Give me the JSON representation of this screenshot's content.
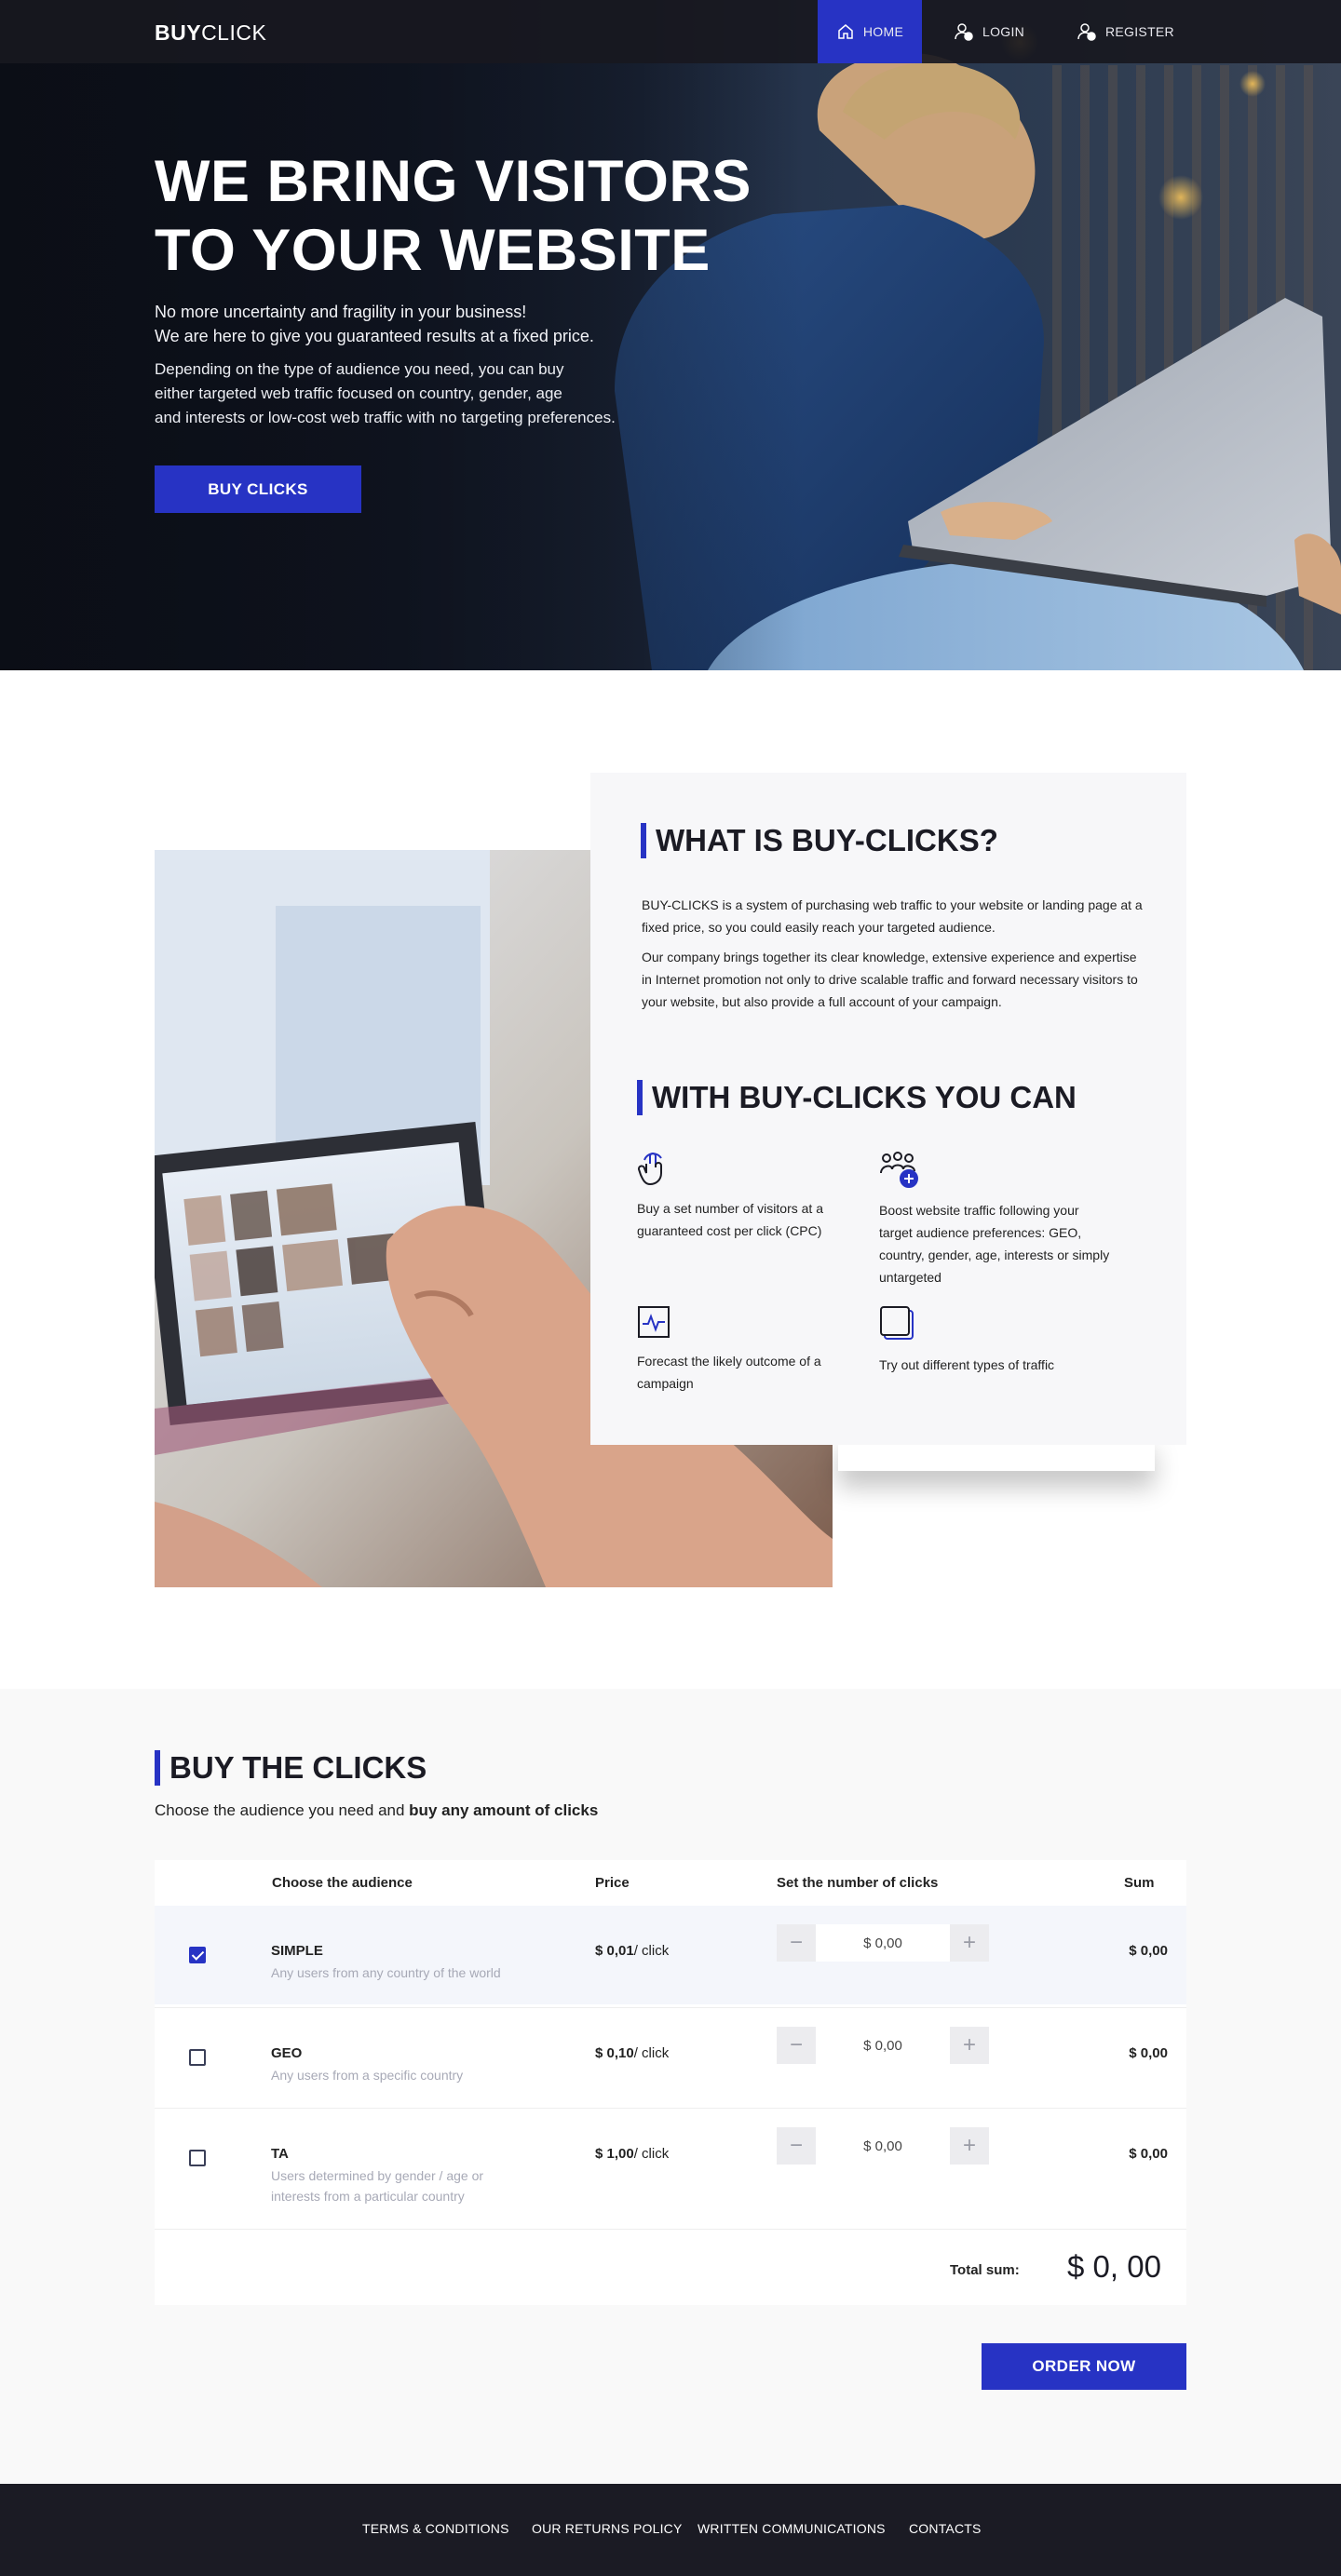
{
  "header": {
    "logo_bold": "BUY",
    "logo_light": "CLICK",
    "nav": {
      "home": "HOME",
      "login": "LOGIN",
      "register": "REGISTER"
    }
  },
  "hero": {
    "title_line1": "WE BRING VISITORS",
    "title_line2": "TO YOUR WEBSITE",
    "text1_line1": "No more uncertainty and fragility in your business!",
    "text1_line2": "We are here  to give you guaranteed results at a fixed price.",
    "text2_line1": "Depending on the type of audience you need, you can buy",
    "text2_line2": "either targeted web traffic focused on country, gender, age",
    "text2_line3": "and interests or low-cost web traffic with no targeting preferences.",
    "button": "BUY CLICKS"
  },
  "about": {
    "title": "WHAT IS BUY-CLICKS?",
    "text1": "BUY-CLICKS is a system of purchasing web traffic to your website or landing page at a fixed price, so you could easily reach your targeted audience.",
    "text2": "Our company brings together its clear knowledge, extensive experience and expertise in  Internet promotion not only to drive scalable traffic and forward necessary visitors to your website, but also provide a full account of your campaign.",
    "features_title": "WITH BUY-CLICKS YOU CAN",
    "features": [
      {
        "icon": "pointer-click-icon",
        "text": "Buy a set number of visitors at a guaranteed cost per click (CPC)"
      },
      {
        "icon": "audience-add-icon",
        "text": "Boost website traffic following your target audience preferences: GEO, country, gender, age, interests or simply untargeted"
      },
      {
        "icon": "pulse-chart-icon",
        "text": "Forecast the likely outcome of a campaign"
      },
      {
        "icon": "layers-icon",
        "text": "Try out different types of traffic"
      }
    ]
  },
  "buy": {
    "title": "BUY THE CLICKS",
    "subtitle_plain": "Choose the audience you need and ",
    "subtitle_bold": "buy any amount of clicks",
    "columns": {
      "audience": "Choose the audience",
      "price": "Price",
      "clicks": "Set the number of clicks",
      "sum": "Sum"
    },
    "rows": [
      {
        "name": "SIMPLE",
        "desc": "Any users from any country of the world",
        "price": "$ 0,01",
        "unit": "/ click",
        "value": "$ 0,00",
        "sum": "$ 0,00",
        "checked": true
      },
      {
        "name": "GEO",
        "desc": "Any users from a specific country",
        "price": "$ 0,10",
        "unit": "/ click",
        "value": "$ 0,00",
        "sum": "$ 0,00",
        "checked": false
      },
      {
        "name": "TA",
        "desc": "Users determined by gender / age or interests from a particular country",
        "price": "$ 1,00",
        "unit": "/ click",
        "value": "$ 0,00",
        "sum": "$ 0,00",
        "checked": false
      }
    ],
    "stepper_minus": "−",
    "stepper_plus": "+",
    "total_label": "Total sum:",
    "total_value": "$ 0, 00",
    "order_button": "ORDER NOW"
  },
  "footer": {
    "links": [
      "TERMS & CONDITIONS",
      "OUR RETURNS POLICY",
      "WRITTEN COMMUNICATIONS",
      "CONTACTS"
    ]
  },
  "colors": {
    "accent": "#2733c4",
    "dark": "#1b1b24",
    "muted": "#a7a9b6"
  }
}
